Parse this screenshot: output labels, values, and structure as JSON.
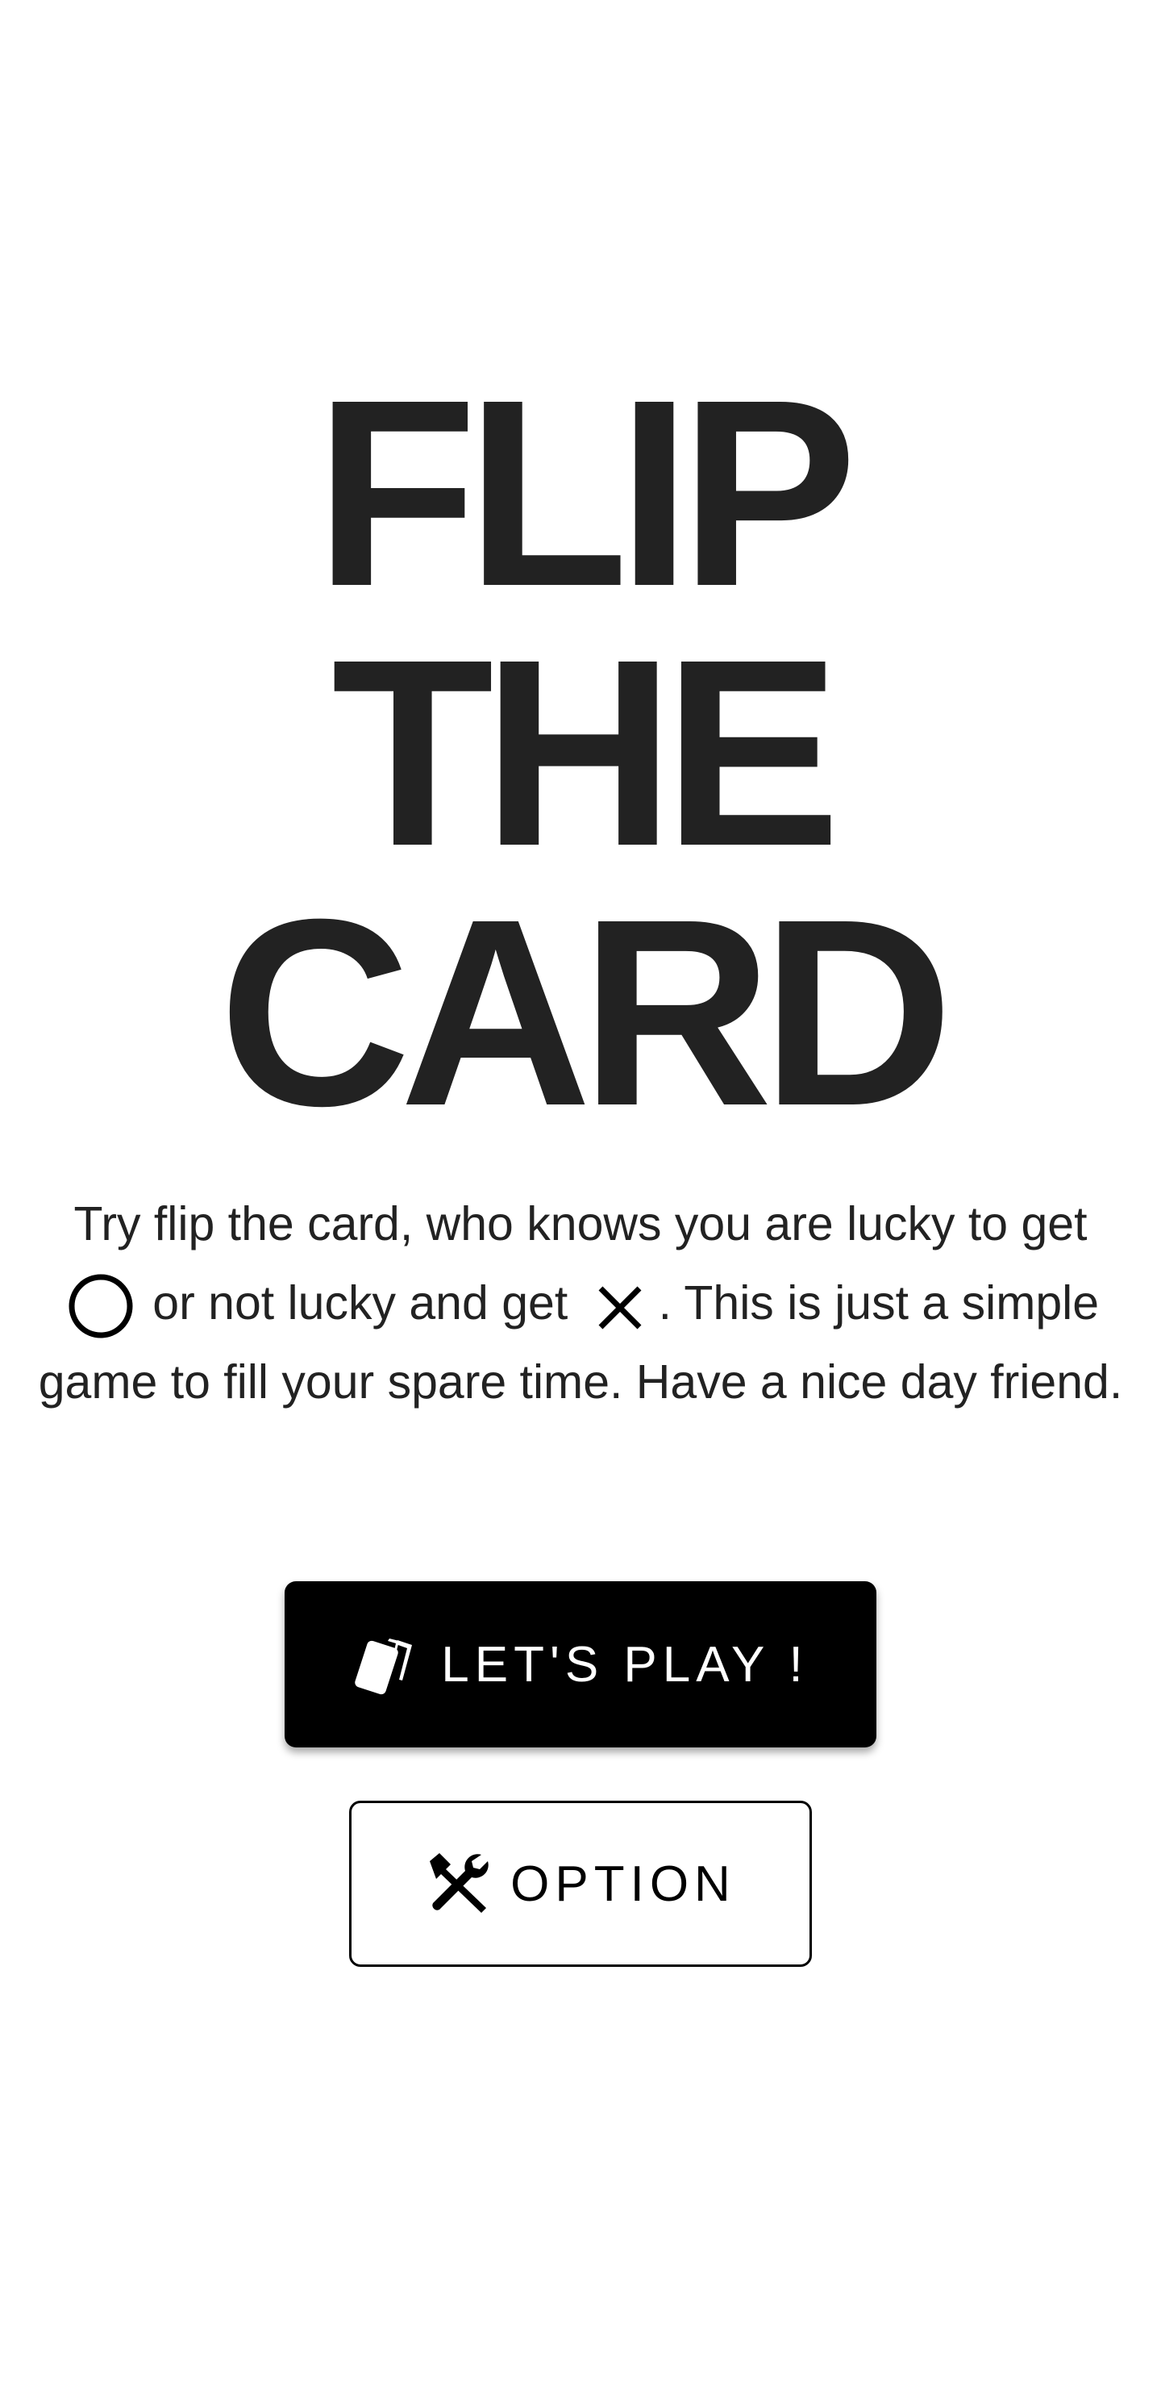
{
  "title": {
    "line1": "FLIP",
    "line2": "THE",
    "line3": "CARD"
  },
  "description": {
    "part1": "Try flip the card, who knows you are lucky to get",
    "circle_icon": "circle-icon",
    "part2": "or not lucky and get",
    "cross_icon": "close-icon",
    "part3": ". This is just a simple game to fill your spare time. Have a nice day friend."
  },
  "buttons": {
    "play": {
      "label": "LET'S PLAY !",
      "icon": "cards-icon"
    },
    "option": {
      "label": "OPTION",
      "icon": "tools-icon"
    }
  },
  "colors": {
    "background": "#ffffff",
    "text": "#222222",
    "primary_button": "#000000",
    "primary_button_text": "#ffffff"
  }
}
